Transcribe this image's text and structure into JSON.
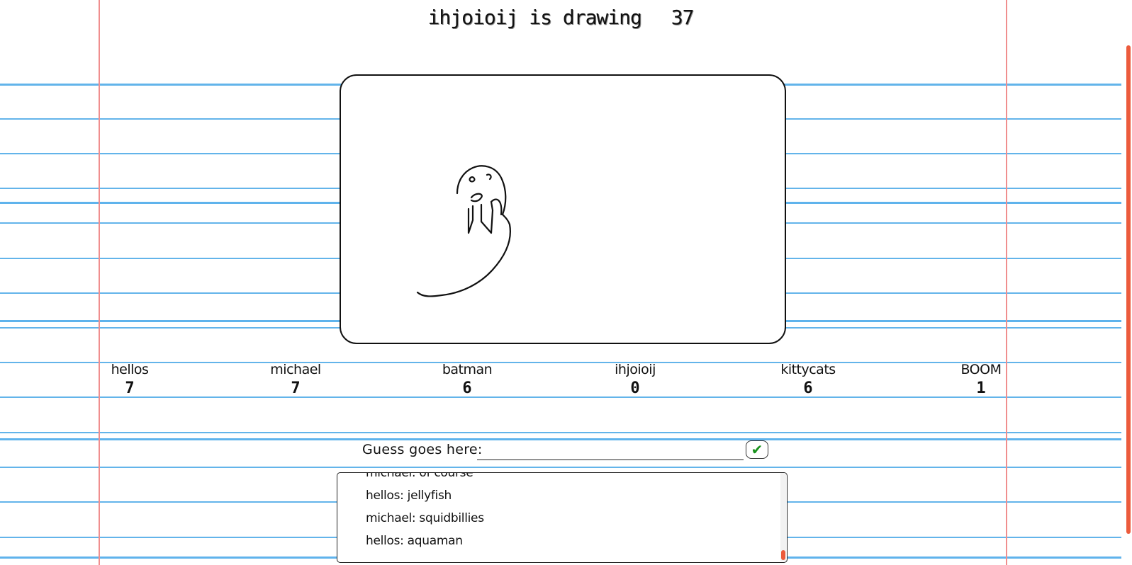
{
  "header": {
    "drawer_text": "ihjoioij is drawing",
    "timer": "37"
  },
  "players": [
    {
      "name": "hellos",
      "score": "7"
    },
    {
      "name": "michael",
      "score": "7"
    },
    {
      "name": "batman",
      "score": "6"
    },
    {
      "name": "ihjoioij",
      "score": "0"
    },
    {
      "name": "kittycats",
      "score": "6"
    },
    {
      "name": "BOOM",
      "score": "1"
    }
  ],
  "guess": {
    "label": "Guess goes here:",
    "value": "",
    "submit_label": "✔"
  },
  "chat": {
    "messages": [
      "michael: of course",
      "hellos: jellyfish",
      "michael: squidbillies",
      "hellos: aquaman"
    ]
  },
  "colors": {
    "rule_line": "#5fb3ec",
    "margin_line": "#f08e8e",
    "scrollbar_thumb": "#ec5b3c",
    "submit_check": "#18921c"
  }
}
